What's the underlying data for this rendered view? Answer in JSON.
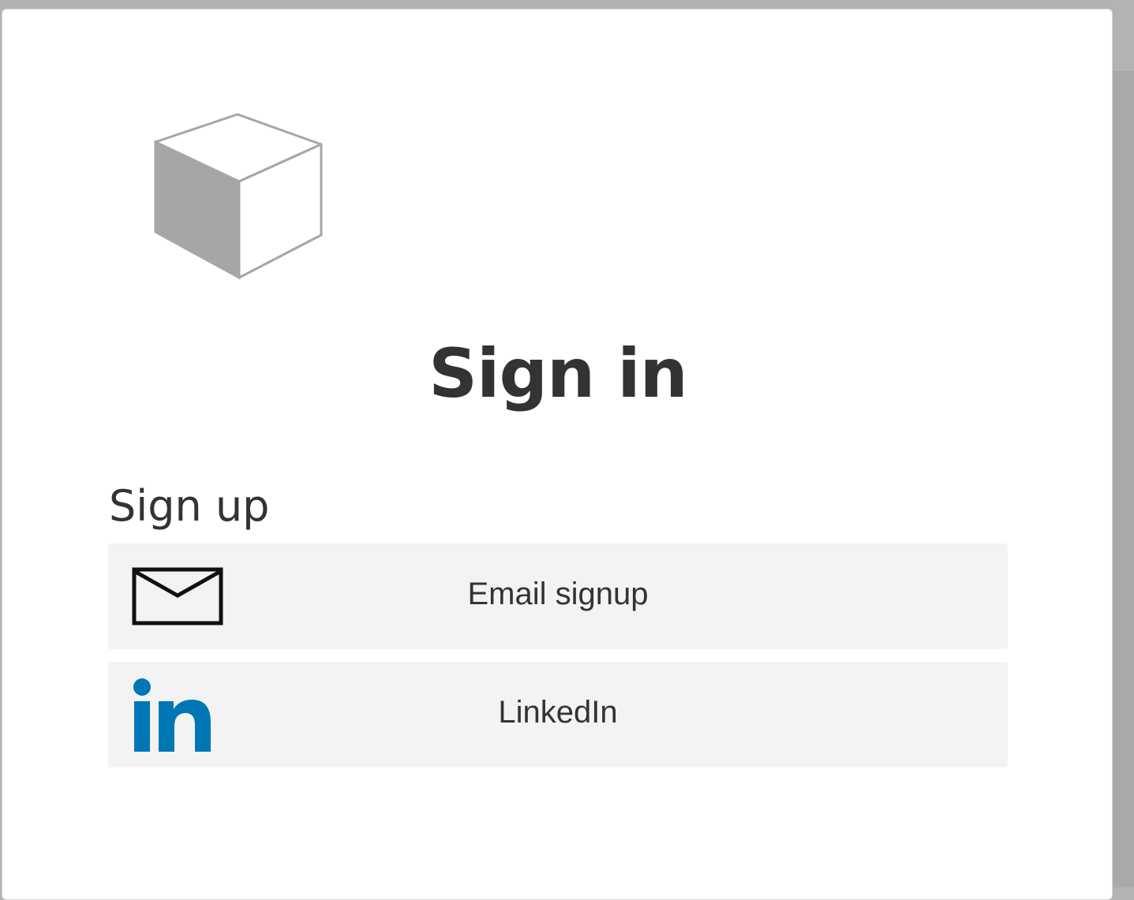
{
  "page": {
    "title": "Sign in"
  },
  "logo": {
    "icon": "cube-logo-icon"
  },
  "signup": {
    "label": "Sign up",
    "providers": [
      {
        "id": "email",
        "label": "Email signup",
        "icon": "envelope-icon"
      },
      {
        "id": "linkedin",
        "label": "LinkedIn",
        "icon": "linkedin-icon",
        "color": "#0077b5"
      }
    ]
  },
  "colors": {
    "text": "#333333",
    "button_bg": "#f3f3f3",
    "backdrop": "#b3b3b3",
    "linkedin": "#0077b5"
  }
}
